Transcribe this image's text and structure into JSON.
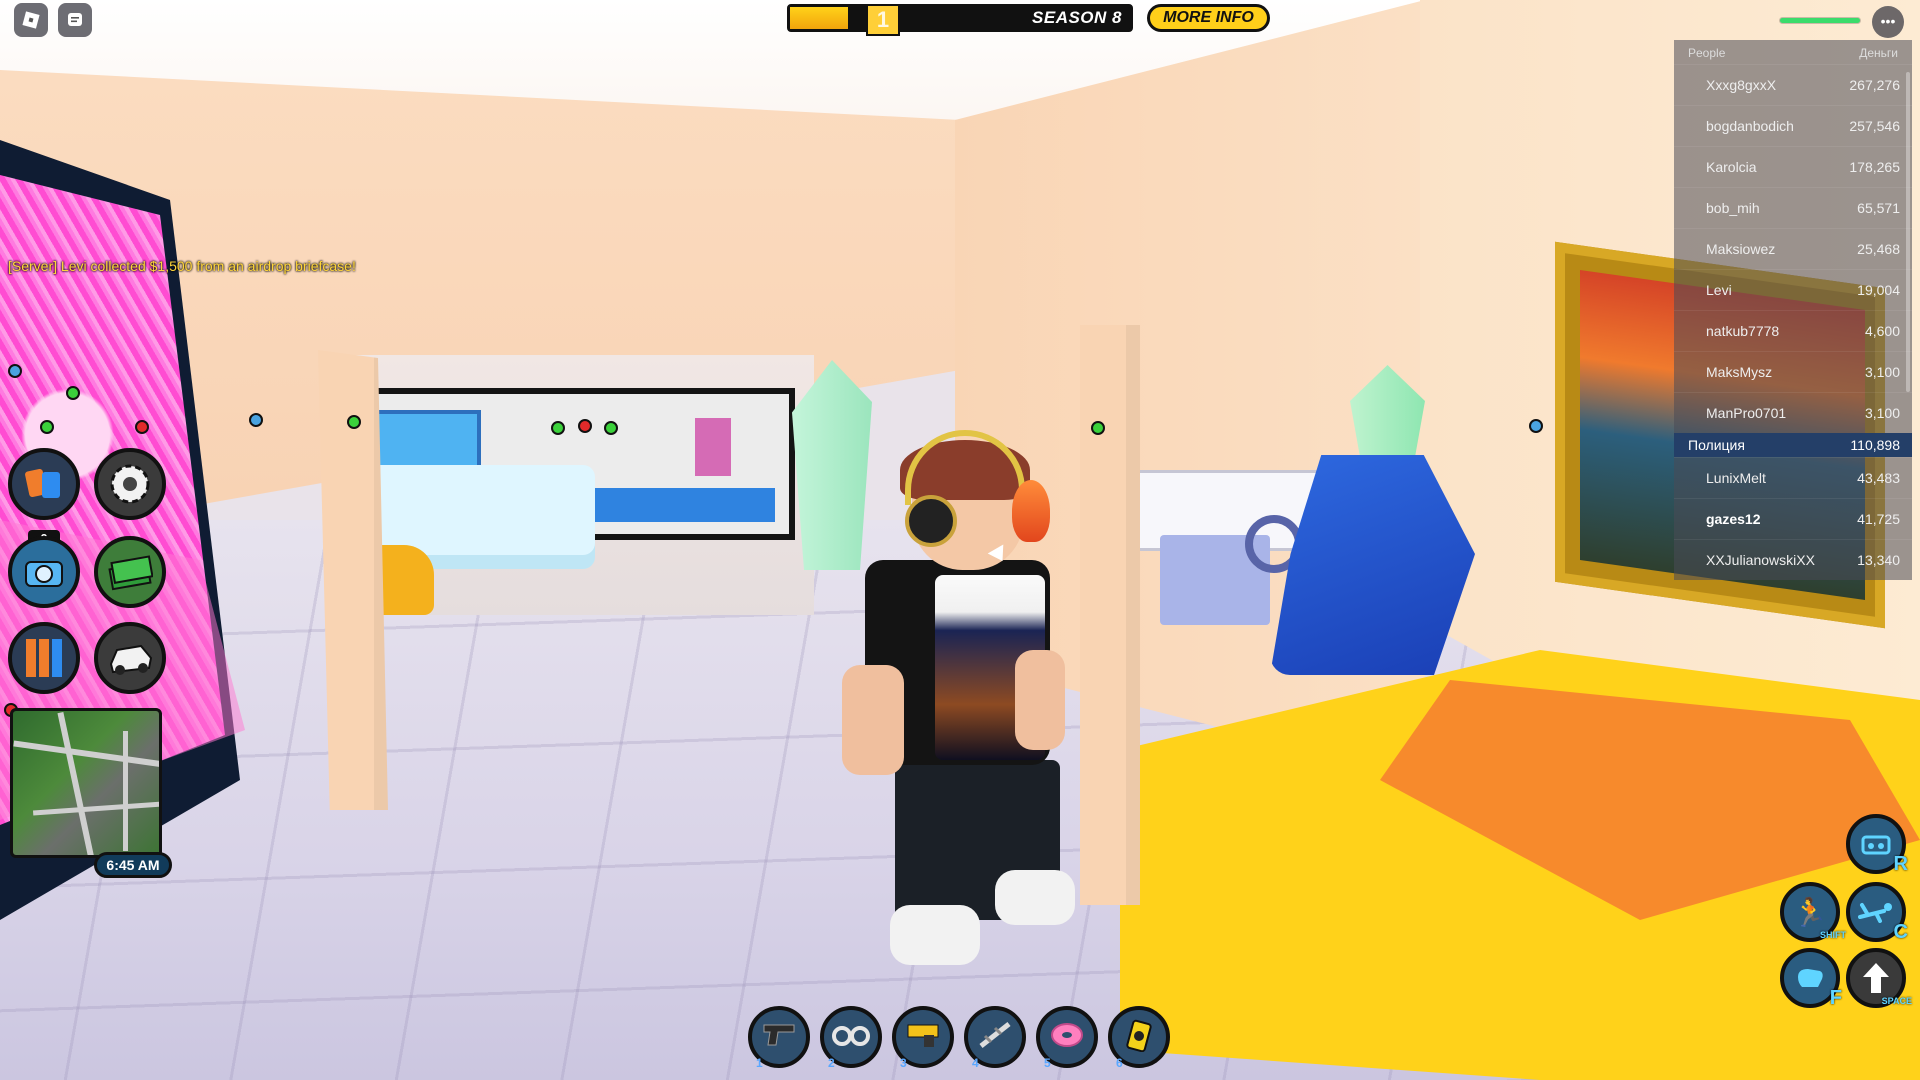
{
  "colors": {
    "accent": "#ffcf1a",
    "team_highlight": "#243f68",
    "chat_server": "#ffd53a"
  },
  "topbar": {
    "roblox_icon": "roblox-logo-icon",
    "chat_icon": "chat-icon",
    "season_level": "1",
    "season_label": "SEASON 8",
    "season_progress": 0.17,
    "more_info_label": "MORE INFO",
    "menu_icon": "more-menu-icon"
  },
  "chat": {
    "message": "[Server] Levi collected $1,500 from an airdrop briefcase!"
  },
  "leaderboard": {
    "header_people": "People",
    "header_money": "Деньги",
    "players_top": [
      {
        "name": "Xxxg8gxxX",
        "value": "267,276"
      },
      {
        "name": "bogdanbodich",
        "value": "257,546"
      },
      {
        "name": "Karolcia",
        "value": "178,265"
      },
      {
        "name": "bob_mih",
        "value": "65,571"
      },
      {
        "name": "Maksiowez",
        "value": "25,468"
      },
      {
        "name": "Levi",
        "value": "19,004"
      },
      {
        "name": "natkub7778",
        "value": "4,600"
      },
      {
        "name": "MaksMysz",
        "value": "3,100"
      },
      {
        "name": "ManPro0701",
        "value": "3,100"
      }
    ],
    "team": {
      "name": "Полиция",
      "value": "110,898"
    },
    "players_team": [
      {
        "name": "LunixMelt",
        "value": "43,483"
      },
      {
        "name": "gazes12",
        "value": "41,725"
      },
      {
        "name": "XXJulianowskiXX",
        "value": "13,340"
      }
    ]
  },
  "left_menu": {
    "count_badge": "0",
    "buttons": [
      "inventory-cards-icon",
      "settings-gear-icon",
      "camera-icon",
      "cash-icon",
      "team-select-icon",
      "vehicle-icon"
    ]
  },
  "minimap": {
    "time": "6:45 AM"
  },
  "hotbar": {
    "slots": [
      {
        "num": "1",
        "icon": "pistol-icon"
      },
      {
        "num": "2",
        "icon": "handcuffs-icon"
      },
      {
        "num": "3",
        "icon": "taser-icon"
      },
      {
        "num": "4",
        "icon": "spike-strip-icon"
      },
      {
        "num": "5",
        "icon": "donut-icon"
      },
      {
        "num": "6",
        "icon": "flashbang-icon"
      }
    ]
  },
  "controls": {
    "radio_key": "R",
    "sprint_key": "SHIFT",
    "crawl_key": "C",
    "punch_key": "F",
    "jump_key": "SPACE"
  }
}
